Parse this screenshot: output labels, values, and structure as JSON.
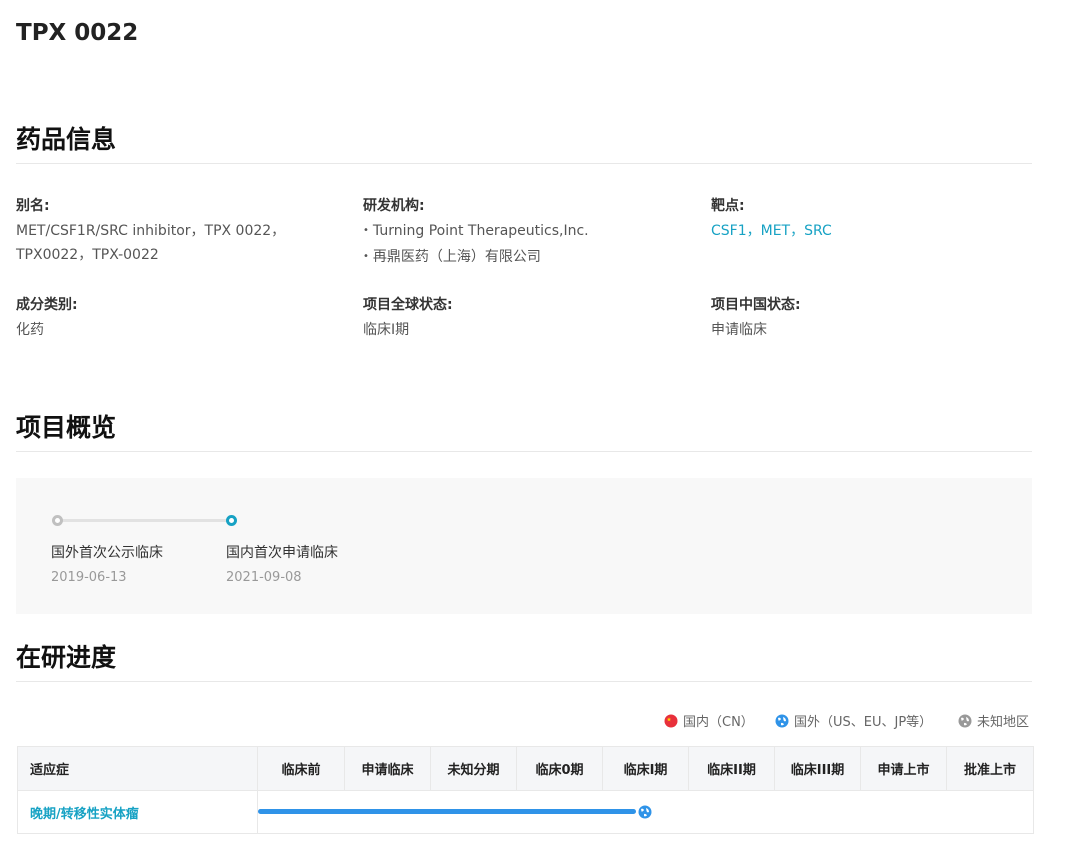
{
  "page": {
    "title": "TPX 0022"
  },
  "drug_info": {
    "section_title": "药品信息",
    "alias": {
      "label": "别名:",
      "value": "MET/CSF1R/SRC inhibitor，TPX 0022，TPX0022，TPX-0022"
    },
    "institution": {
      "label": "研发机构:",
      "items": [
        "Turning Point Therapeutics,Inc.",
        "再鼎医药（上海）有限公司"
      ]
    },
    "target": {
      "label": "靶点:",
      "items": [
        "CSF1",
        "MET",
        "SRC"
      ],
      "separator": "，"
    },
    "component": {
      "label": "成分类别:",
      "value": "化药"
    },
    "global_status": {
      "label": "项目全球状态:",
      "value": "临床I期"
    },
    "china_status": {
      "label": "项目中国状态:",
      "value": "申请临床"
    }
  },
  "overview": {
    "section_title": "项目概览",
    "timeline": [
      {
        "event": "国外首次公示临床",
        "date": "2019-06-13",
        "status": "past"
      },
      {
        "event": "国内首次申请临床",
        "date": "2021-09-08",
        "status": "current"
      }
    ]
  },
  "progress": {
    "section_title": "在研进度",
    "legend": [
      {
        "label": "国内（CN）",
        "icon": "china-flag-icon",
        "color": "#e8303b"
      },
      {
        "label": "国外（US、EU、JP等）",
        "icon": "globe-icon",
        "color": "#2f93e8"
      },
      {
        "label": "未知地区",
        "icon": "globe-unknown-icon",
        "color": "#999999"
      }
    ],
    "columns": [
      "适应症",
      "临床前",
      "申请临床",
      "未知分期",
      "临床0期",
      "临床I期",
      "临床II期",
      "临床III期",
      "申请上市",
      "批准上市"
    ],
    "rows": [
      {
        "indication": "晚期/转移性实体瘤",
        "reached_stage": "临床I期",
        "region": "国外（US、EU、JP等）"
      }
    ],
    "colors": {
      "bar": "#2f93e8",
      "link": "#17a2c4"
    }
  }
}
